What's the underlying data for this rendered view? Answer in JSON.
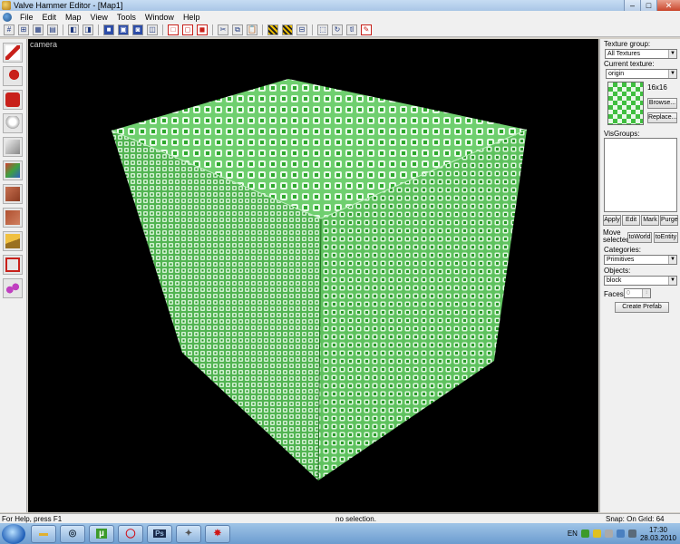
{
  "window": {
    "title": "Valve Hammer Editor - [Map1]"
  },
  "menu": [
    "File",
    "Edit",
    "Map",
    "View",
    "Tools",
    "Window",
    "Help"
  ],
  "viewport": {
    "label": "camera"
  },
  "panel": {
    "texture_group_label": "Texture group:",
    "texture_group_value": "All Textures",
    "current_texture_label": "Current texture:",
    "current_texture_value": "origin",
    "texture_size": "16x16",
    "browse_label": "Browse...",
    "replace_label": "Replace...",
    "visgroups_label": "VisGroups:",
    "apply_label": "Apply",
    "edit_label": "Edit",
    "mark_label": "Mark",
    "purge_label": "Purge",
    "move_selected_label": "Move selected",
    "to_world_label": "toWorld",
    "to_entity_label": "toEntity",
    "categories_label": "Categories:",
    "categories_value": "Primitives",
    "objects_label": "Objects:",
    "objects_value": "block",
    "faces_label": "Faces:",
    "faces_value": "0",
    "create_prefab_label": "Create Prefab"
  },
  "status": {
    "help": "For Help, press F1",
    "selection": "no selection.",
    "snap": "Snap: On Grid: 64"
  },
  "taskbar": {
    "ps_label": "Ps",
    "utorrent_label": "µ",
    "lang": "EN",
    "time": "17:30",
    "date": "28.03.2010"
  }
}
